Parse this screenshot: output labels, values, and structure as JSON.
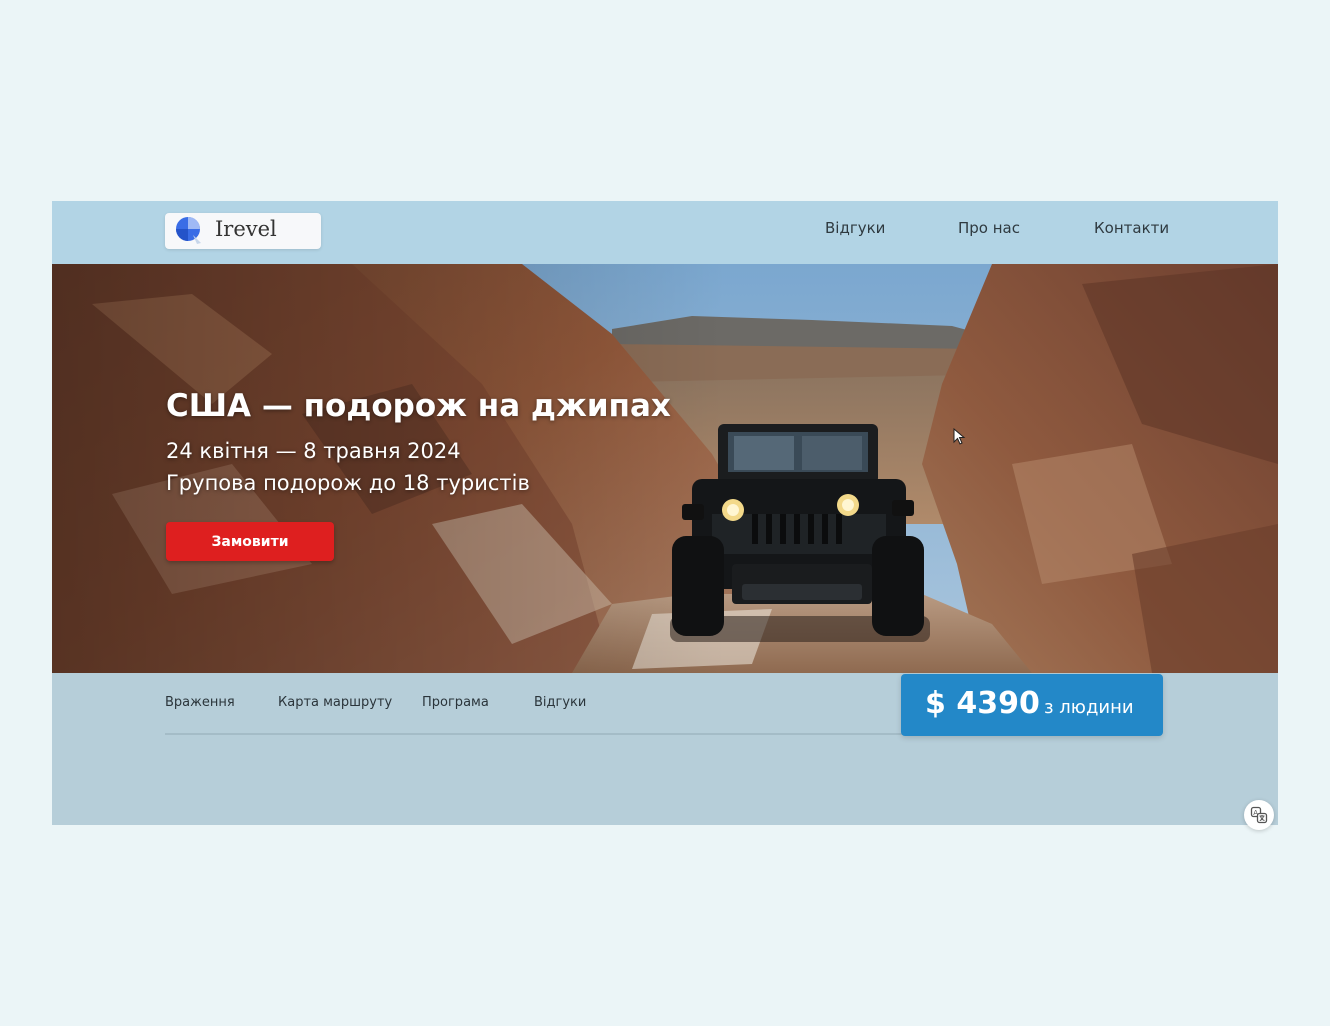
{
  "header": {
    "logo_text": "Irevel",
    "nav": [
      {
        "label": "Відгуки"
      },
      {
        "label": "Про нас"
      },
      {
        "label": "Контакти"
      }
    ]
  },
  "hero": {
    "title": "США — подорож на джипах",
    "dates": "24 квітня — 8 травня 2024",
    "group": "Групова подорож до 18 туристів",
    "cta_label": "Замовити",
    "image": "jeep-canyon-photo"
  },
  "subnav": {
    "items": [
      {
        "label": "Враження"
      },
      {
        "label": "Карта маршруту"
      },
      {
        "label": "Програма"
      },
      {
        "label": "Відгуки"
      }
    ]
  },
  "price": {
    "amount": "$ 4390",
    "unit": "з людини"
  },
  "icons": {
    "translate": "translate-icon",
    "cursor": "mouse-cursor-icon"
  },
  "colors": {
    "page_bg": "#ebf5f7",
    "topbar": "#b2d4e5",
    "cta": "#de1f1f",
    "price_bg": "#2388c8"
  }
}
